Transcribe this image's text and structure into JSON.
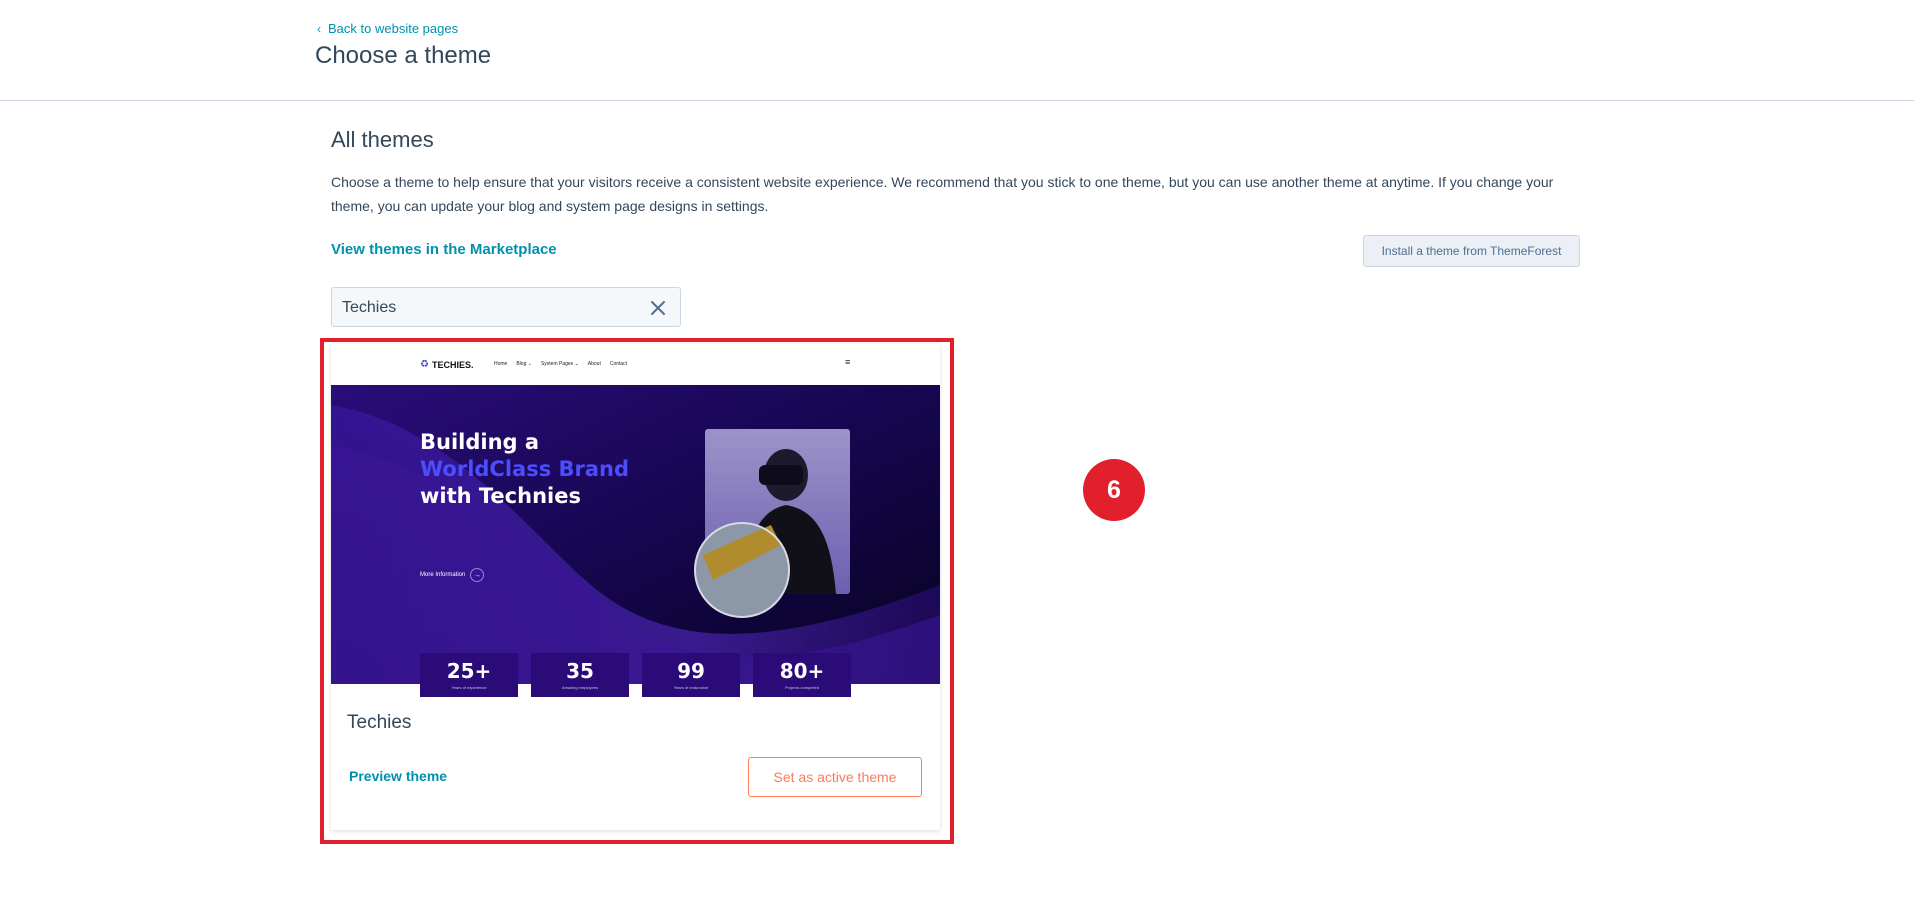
{
  "header": {
    "back_label": "Back to website pages",
    "title": "Choose a theme"
  },
  "section": {
    "title": "All themes",
    "description": "Choose a theme to help ensure that your visitors receive a consistent website experience. We recommend that you stick to one theme, but you can use another theme at anytime. If you change your theme, you can update your blog and system page designs in settings.",
    "marketplace_link": "View themes in the Marketplace",
    "install_button": "Install a theme from ThemeForest"
  },
  "search": {
    "value": "Techies"
  },
  "theme_card": {
    "name": "Techies",
    "preview_label": "Preview theme",
    "set_active_label": "Set as active theme",
    "thumbnail": {
      "logo": "TECHIES.",
      "menu": [
        "Home",
        "Blog ⌄",
        "System Pages ⌄",
        "About",
        "Contact"
      ],
      "headline_line1": "Building a",
      "headline_line2": "WorldClass Brand",
      "headline_line3": "with Technies",
      "more_info": "More Information",
      "stats": [
        {
          "value": "25+",
          "label": "Years of experience"
        },
        {
          "value": "35",
          "label": "Amazing employees"
        },
        {
          "value": "99",
          "label": "Years of endurance"
        },
        {
          "value": "80+",
          "label": "Projects completed"
        }
      ]
    }
  },
  "annotation": {
    "step_number": "6",
    "highlight_color": "#e2202c"
  },
  "colors": {
    "link": "#0091ae",
    "accent": "#ff7a59",
    "text": "#33475b",
    "hero_bg": "#1c0a5e"
  }
}
